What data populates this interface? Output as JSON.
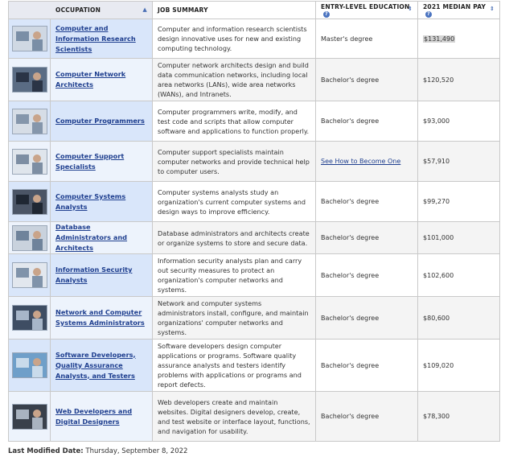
{
  "headers": {
    "occupation": "OCCUPATION",
    "summary": "JOB SUMMARY",
    "education": "ENTRY-LEVEL EDUCATION",
    "pay": "2021 MEDIAN PAY"
  },
  "rows": [
    {
      "title": "Computer and Information Research Scientists",
      "summary": "Computer and information research scientists design innovative uses for new and existing computing technology.",
      "education": "Master's degree",
      "pay": "$131,490",
      "img": "person-at-monitor-thumbnail"
    },
    {
      "title": "Computer Network Architects",
      "summary": "Computer network architects design and build data communication networks, including local area networks (LANs), wide area networks (WANs), and Intranets.",
      "education": "Bachelor's degree",
      "pay": "$120,520",
      "img": "server-room-thumbnail"
    },
    {
      "title": "Computer Programmers",
      "summary": "Computer programmers write, modify, and test code and scripts that allow computer software and applications to function properly.",
      "education": "Bachelor's degree",
      "pay": "$93,000",
      "img": "programmer-thumbnail"
    },
    {
      "title": "Computer Support Specialists",
      "summary": "Computer support specialists maintain computer networks and provide technical help to computer users.",
      "education": "See How to Become One",
      "pay": "$57,910",
      "img": "support-desk-thumbnail"
    },
    {
      "title": "Computer Systems Analysts",
      "summary": "Computer systems analysts study an organization's current computer systems and design ways to improve efficiency.",
      "education": "Bachelor's degree",
      "pay": "$99,270",
      "img": "analysts-meeting-thumbnail"
    },
    {
      "title": "Database Administrators and Architects",
      "summary": "Database administrators and architects create or organize systems to store and secure data.",
      "education": "Bachelor's degree",
      "pay": "$101,000",
      "img": "database-team-thumbnail"
    },
    {
      "title": "Information Security Analysts",
      "summary": "Information security analysts plan and carry out security measures to protect an organization's computer networks and systems.",
      "education": "Bachelor's degree",
      "pay": "$102,600",
      "img": "security-analyst-thumbnail"
    },
    {
      "title": "Network and Computer Systems Administrators",
      "summary": "Network and computer systems administrators install, configure, and maintain organizations' computer networks and systems.",
      "education": "Bachelor's degree",
      "pay": "$80,600",
      "img": "network-admin-thumbnail"
    },
    {
      "title": "Software Developers, Quality Assurance Analysts, and Testers",
      "summary": "Software developers design computer applications or programs. Software quality assurance analysts and testers identify problems with applications or programs and report defects.",
      "education": "Bachelor's degree",
      "pay": "$109,020",
      "img": "software-developer-thumbnail"
    },
    {
      "title": "Web Developers and Digital Designers",
      "summary": "Web developers create and maintain websites. Digital designers develop, create, and test website or interface layout, functions, and navigation for usability.",
      "education": "Bachelor's degree",
      "pay": "$78,300",
      "img": "web-developer-thumbnail"
    }
  ],
  "footer": {
    "label": "Last Modified Date:",
    "value": "Thursday, September 8, 2022"
  },
  "colors": {
    "link": "#1f3f8f",
    "row_highlight": "#d9e6fa",
    "row_alt": "#edf3fc",
    "border": "#c9c9c9"
  }
}
